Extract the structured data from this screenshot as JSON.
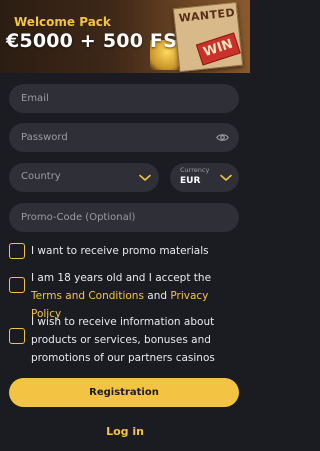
{
  "banner": {
    "welcome": "Welcome Pack",
    "amount": "€5000 + 500 FS",
    "poster_title": "WANTED",
    "poster_sign": "WIN"
  },
  "form": {
    "email_placeholder": "Email",
    "password_placeholder": "Password",
    "country_placeholder": "Country",
    "currency_caption": "Currency",
    "currency_value": "EUR",
    "promo_placeholder": "Promo-Code (Optional)"
  },
  "checks": {
    "promo": "I want to receive promo materials",
    "age_prefix": "I am 18 years old and I accept the ",
    "terms_link": "Terms and Conditions",
    "age_and": " and ",
    "privacy_link": "Privacy Policy",
    "partners": "I wish to receive information about products or services, bonuses and promotions of our partners casinos"
  },
  "actions": {
    "register": "Registration",
    "login": "Log in"
  },
  "colors": {
    "accent": "#f3c443",
    "background": "#1b1c22",
    "field": "#2e2f37"
  },
  "icons": [
    "eye-icon",
    "chevron-down-icon"
  ]
}
